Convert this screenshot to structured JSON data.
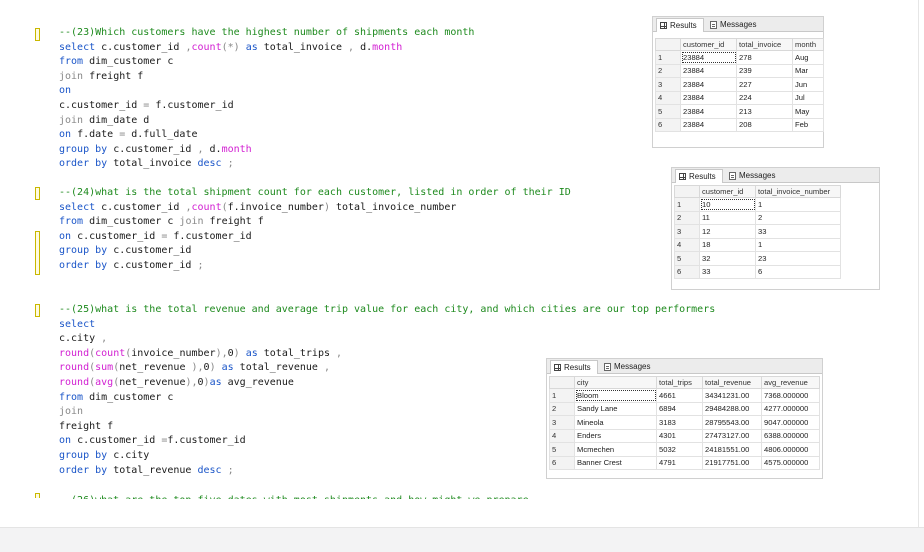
{
  "query23": {
    "lines": [
      [
        {
          "t": "--(23)Which customers have the highest number of shipments each month",
          "c": "cm"
        }
      ],
      [
        {
          "t": "select ",
          "c": "kw"
        },
        {
          "t": "c.customer_id ",
          "c": "id"
        },
        {
          "t": ",",
          "c": "op"
        },
        {
          "t": "count",
          "c": "fn"
        },
        {
          "t": "(*) ",
          "c": "op"
        },
        {
          "t": "as ",
          "c": "kw"
        },
        {
          "t": "total_invoice ",
          "c": "id"
        },
        {
          "t": ", ",
          "c": "op"
        },
        {
          "t": "d.",
          "c": "id"
        },
        {
          "t": "month",
          "c": "fn"
        }
      ],
      [
        {
          "t": "from ",
          "c": "kw"
        },
        {
          "t": "dim_customer c",
          "c": "id"
        }
      ],
      [
        {
          "t": "join ",
          "c": "op"
        },
        {
          "t": "freight f",
          "c": "id"
        }
      ],
      [
        {
          "t": "on",
          "c": "kw"
        }
      ],
      [
        {
          "t": "c.customer_id ",
          "c": "id"
        },
        {
          "t": "= ",
          "c": "op"
        },
        {
          "t": "f.customer_id",
          "c": "id"
        }
      ],
      [
        {
          "t": "join ",
          "c": "op"
        },
        {
          "t": "dim_date d",
          "c": "id"
        }
      ],
      [
        {
          "t": "on ",
          "c": "kw"
        },
        {
          "t": "f.date ",
          "c": "id"
        },
        {
          "t": "= ",
          "c": "op"
        },
        {
          "t": "d.full_date",
          "c": "id"
        }
      ],
      [
        {
          "t": "group by ",
          "c": "kw"
        },
        {
          "t": "c.customer_id ",
          "c": "id"
        },
        {
          "t": ", ",
          "c": "op"
        },
        {
          "t": "d.",
          "c": "id"
        },
        {
          "t": "month",
          "c": "fn"
        }
      ],
      [
        {
          "t": "order by ",
          "c": "kw"
        },
        {
          "t": "total_invoice ",
          "c": "id"
        },
        {
          "t": "desc ",
          "c": "kw"
        },
        {
          "t": ";",
          "c": "op"
        }
      ]
    ]
  },
  "query24": {
    "lines": [
      [
        {
          "t": "--(24)what is the total shipment count for each customer, listed in order of their ID",
          "c": "cm"
        }
      ],
      [
        {
          "t": "select ",
          "c": "kw"
        },
        {
          "t": "c.customer_id ",
          "c": "id"
        },
        {
          "t": ",",
          "c": "op"
        },
        {
          "t": "count",
          "c": "fn"
        },
        {
          "t": "(",
          "c": "op"
        },
        {
          "t": "f.invoice_number",
          "c": "id"
        },
        {
          "t": ") ",
          "c": "op"
        },
        {
          "t": "total_invoice_number",
          "c": "id"
        }
      ],
      [
        {
          "t": "from ",
          "c": "kw"
        },
        {
          "t": "dim_customer c ",
          "c": "id"
        },
        {
          "t": "join ",
          "c": "op"
        },
        {
          "t": "freight f",
          "c": "id"
        }
      ],
      [
        {
          "t": "on ",
          "c": "kw"
        },
        {
          "t": "c.customer_id ",
          "c": "id"
        },
        {
          "t": "= ",
          "c": "op"
        },
        {
          "t": "f.customer_id",
          "c": "id"
        }
      ],
      [
        {
          "t": "group by ",
          "c": "kw"
        },
        {
          "t": "c.customer_id",
          "c": "id"
        }
      ],
      [
        {
          "t": "order by ",
          "c": "kw"
        },
        {
          "t": "c.customer_id ",
          "c": "id"
        },
        {
          "t": ";",
          "c": "op"
        }
      ]
    ]
  },
  "query25": {
    "lines": [
      [
        {
          "t": "--(25)what is the total revenue and average trip value for each city, and which cities are our top performers",
          "c": "cm"
        }
      ],
      [
        {
          "t": "select",
          "c": "kw"
        }
      ],
      [
        {
          "t": "c.city ",
          "c": "id"
        },
        {
          "t": ",",
          "c": "op"
        }
      ],
      [
        {
          "t": "round",
          "c": "fn"
        },
        {
          "t": "(",
          "c": "op"
        },
        {
          "t": "count",
          "c": "fn"
        },
        {
          "t": "(",
          "c": "op"
        },
        {
          "t": "invoice_number",
          "c": "id"
        },
        {
          "t": "),",
          "c": "op"
        },
        {
          "t": "0",
          "c": "id"
        },
        {
          "t": ") ",
          "c": "op"
        },
        {
          "t": "as ",
          "c": "kw"
        },
        {
          "t": "total_trips ",
          "c": "id"
        },
        {
          "t": ",",
          "c": "op"
        }
      ],
      [
        {
          "t": "round",
          "c": "fn"
        },
        {
          "t": "(",
          "c": "op"
        },
        {
          "t": "sum",
          "c": "fn"
        },
        {
          "t": "(",
          "c": "op"
        },
        {
          "t": "net_revenue ",
          "c": "id"
        },
        {
          "t": "),",
          "c": "op"
        },
        {
          "t": "0",
          "c": "id"
        },
        {
          "t": ") ",
          "c": "op"
        },
        {
          "t": "as ",
          "c": "kw"
        },
        {
          "t": "total_revenue ",
          "c": "id"
        },
        {
          "t": ",",
          "c": "op"
        }
      ],
      [
        {
          "t": "round",
          "c": "fn"
        },
        {
          "t": "(",
          "c": "op"
        },
        {
          "t": "avg",
          "c": "fn"
        },
        {
          "t": "(",
          "c": "op"
        },
        {
          "t": "net_revenue",
          "c": "id"
        },
        {
          "t": "),",
          "c": "op"
        },
        {
          "t": "0",
          "c": "id"
        },
        {
          "t": ")",
          "c": "op"
        },
        {
          "t": "as ",
          "c": "kw"
        },
        {
          "t": "avg_revenue",
          "c": "id"
        }
      ],
      [
        {
          "t": "from ",
          "c": "kw"
        },
        {
          "t": "dim_customer c",
          "c": "id"
        }
      ],
      [
        {
          "t": "join",
          "c": "op"
        }
      ],
      [
        {
          "t": "freight f",
          "c": "id"
        }
      ],
      [
        {
          "t": "on ",
          "c": "kw"
        },
        {
          "t": "c.customer_id ",
          "c": "id"
        },
        {
          "t": "=",
          "c": "op"
        },
        {
          "t": "f.customer_id",
          "c": "id"
        }
      ],
      [
        {
          "t": "group by ",
          "c": "kw"
        },
        {
          "t": "c.city",
          "c": "id"
        }
      ],
      [
        {
          "t": "order by ",
          "c": "kw"
        },
        {
          "t": "total_revenue ",
          "c": "id"
        },
        {
          "t": "desc ",
          "c": "kw"
        },
        {
          "t": ";",
          "c": "op"
        }
      ]
    ]
  },
  "result_tabs": {
    "results": "Results",
    "messages": "Messages"
  },
  "result1": {
    "columns": [
      "customer_id",
      "total_invoice",
      "month"
    ],
    "rows": [
      [
        "1",
        "23884",
        "278",
        "Aug"
      ],
      [
        "2",
        "23884",
        "239",
        "Mar"
      ],
      [
        "3",
        "23884",
        "227",
        "Jun"
      ],
      [
        "4",
        "23884",
        "224",
        "Jul"
      ],
      [
        "5",
        "23884",
        "213",
        "May"
      ],
      [
        "6",
        "23884",
        "208",
        "Feb"
      ]
    ]
  },
  "result2": {
    "columns": [
      "customer_id",
      "total_invoice_number"
    ],
    "rows": [
      [
        "1",
        "10",
        "1"
      ],
      [
        "2",
        "11",
        "2"
      ],
      [
        "3",
        "12",
        "33"
      ],
      [
        "4",
        "18",
        "1"
      ],
      [
        "5",
        "32",
        "23"
      ],
      [
        "6",
        "33",
        "6"
      ]
    ]
  },
  "result3": {
    "columns": [
      "city",
      "total_trips",
      "total_revenue",
      "avg_revenue"
    ],
    "rows": [
      [
        "1",
        "Bloom",
        "4661",
        "34341231.00",
        "7368.000000"
      ],
      [
        "2",
        "Sandy Lane",
        "6894",
        "29484288.00",
        "4277.000000"
      ],
      [
        "3",
        "Mineola",
        "3183",
        "28795543.00",
        "9047.000000"
      ],
      [
        "4",
        "Enders",
        "4301",
        "27473127.00",
        "6388.000000"
      ],
      [
        "5",
        "Mcmechen",
        "5032",
        "24181551.00",
        "4806.000000"
      ],
      [
        "6",
        "Banner Crest",
        "4791",
        "21917751.00",
        "4575.000000"
      ]
    ]
  },
  "truncated_line": "--(26)what are the top five dates with most shipments and how might we prepare"
}
